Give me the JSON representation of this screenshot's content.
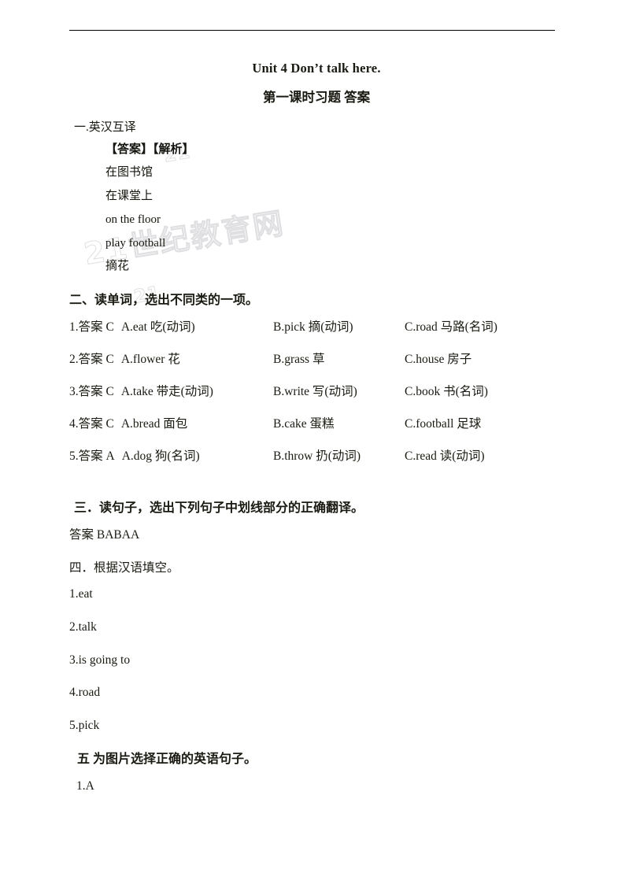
{
  "document": {
    "title": "Unit 4 Don’t talk here.",
    "subtitle": "第一课时习题  答案"
  },
  "section_one": {
    "heading": "一.英汉互译",
    "answer_analysis_label": "【答案】【解析】",
    "lines": [
      "在图书馆",
      "在课堂上",
      "on the floor",
      "play football",
      "摘花"
    ]
  },
  "section_two": {
    "heading": "二、读单词，选出不同类的一项。",
    "rows": [
      {
        "answer": "1.答案 C",
        "a": "A.eat 吃(动词)",
        "b": "B.pick 摘(动词)",
        "c": "C.road 马路(名词)"
      },
      {
        "answer": "2.答案 C",
        "a": "A.flower 花",
        "b": "B.grass 草",
        "c": "C.house 房子"
      },
      {
        "answer": "3.答案 C",
        "a": "A.take 带走(动词)",
        "b": "B.write 写(动词)",
        "c": "C.book 书(名词)"
      },
      {
        "answer": "4.答案 C",
        "a": "A.bread 面包",
        "b": "B.cake 蛋糕",
        "c": "C.football 足球"
      },
      {
        "answer": "5.答案 A",
        "a": "A.dog  狗(名词)",
        "b": "B.throw 扔(动词)",
        "c": "C.read 读(动词)"
      }
    ]
  },
  "section_three": {
    "heading": "三．读句子，选出下列句子中划线部分的正确翻译。",
    "answer": "答案 BABAA"
  },
  "section_four": {
    "heading": "四．根据汉语填空。",
    "answers": [
      "1.eat",
      "2.talk",
      "3.is going to",
      "4.road",
      "5.pick"
    ]
  },
  "section_five": {
    "heading": "五  为图片选择正确的英语句子。",
    "answers": [
      "1.A"
    ]
  },
  "watermark": {
    "text_main": "21世纪教育网",
    "text_small": "21"
  },
  "colors": {
    "text": "#1a1a12",
    "rule": "#000000",
    "watermark": "#96969f"
  }
}
